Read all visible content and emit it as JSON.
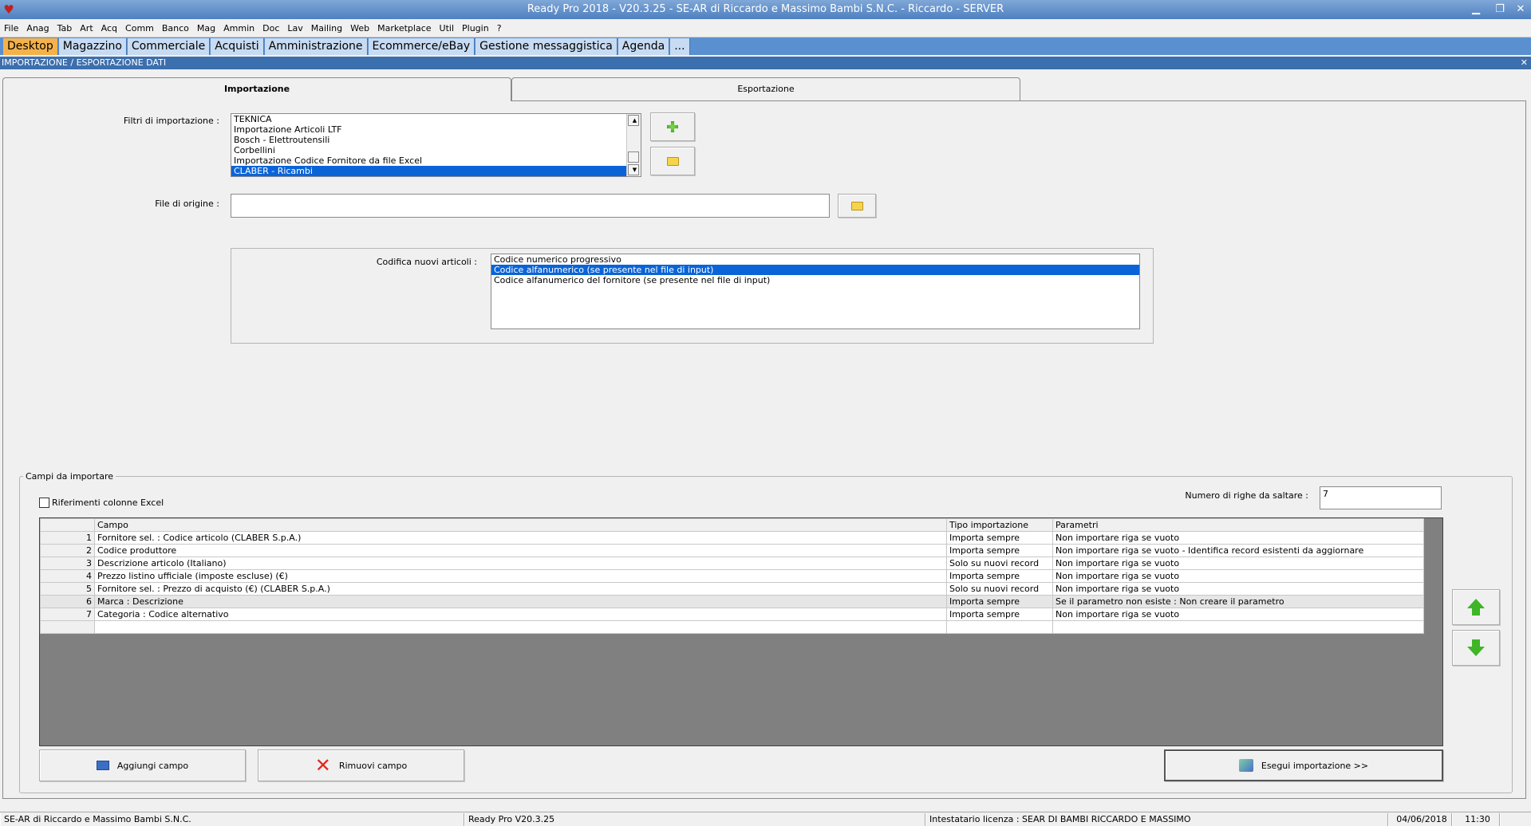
{
  "window": {
    "title": "Ready Pro 2018 - V20.3.25 - SE-AR di Riccardo e Massimo Bambi S.N.C. - Riccardo - SERVER"
  },
  "menu": [
    "File",
    "Anag",
    "Tab",
    "Art",
    "Acq",
    "Comm",
    "Banco",
    "Mag",
    "Ammin",
    "Doc",
    "Lav",
    "Mailing",
    "Web",
    "Marketplace",
    "Util",
    "Plugin",
    "?"
  ],
  "tabs": [
    "Desktop",
    "Magazzino",
    "Commerciale",
    "Acquisti",
    "Amministrazione",
    "Ecommerce/eBay",
    "Gestione messaggistica",
    "Agenda",
    "..."
  ],
  "module_title": "IMPORTAZIONE / ESPORTAZIONE DATI",
  "panel_tabs": {
    "import": "Importazione",
    "export": "Esportazione"
  },
  "filters": {
    "label": "Filtri di importazione :",
    "items": [
      "TEKNICA",
      "Importazione Articoli LTF",
      "Bosch - Elettroutensili",
      "Corbellini",
      "Importazione Codice Fornitore da file Excel",
      "CLABER - Ricambi"
    ],
    "selected": "CLABER - Ricambi"
  },
  "origin_file": {
    "label": "File di origine :",
    "value": ""
  },
  "coding": {
    "label": "Codifica nuovi articoli :",
    "items": [
      "Codice numerico progressivo",
      "Codice alfanumerico (se presente nel file di input)",
      "Codice alfanumerico del fornitore (se presente nel file di input)"
    ],
    "selected": "Codice alfanumerico (se presente nel file di input)"
  },
  "fields_group": {
    "legend": "Campi da importare",
    "excel_refs_label": "Riferimenti colonne Excel",
    "skip_rows_label": "Numero di righe da saltare :",
    "skip_rows_value": "7",
    "columns": [
      "",
      "Campo",
      "Tipo importazione",
      "Parametri"
    ],
    "rows": [
      {
        "n": "1",
        "campo": "Fornitore sel. : Codice articolo (CLABER S.p.A.)",
        "tipo": "Importa sempre",
        "param": "Non importare riga se vuoto"
      },
      {
        "n": "2",
        "campo": "Codice produttore",
        "tipo": "Importa sempre",
        "param": "Non importare riga se vuoto - Identifica record esistenti da aggiornare"
      },
      {
        "n": "3",
        "campo": "Descrizione articolo (Italiano)",
        "tipo": "Solo su nuovi record",
        "param": "Non importare riga se vuoto"
      },
      {
        "n": "4",
        "campo": "Prezzo listino ufficiale (imposte escluse) (€)",
        "tipo": "Importa sempre",
        "param": "Non importare riga se vuoto"
      },
      {
        "n": "5",
        "campo": "Fornitore sel. : Prezzo di acquisto (€) (CLABER S.p.A.)",
        "tipo": "Solo su nuovi record",
        "param": "Non importare riga se vuoto"
      },
      {
        "n": "6",
        "campo": "Marca : Descrizione",
        "tipo": "Importa sempre",
        "param": "Se il parametro non esiste : Non creare il parametro"
      },
      {
        "n": "7",
        "campo": "Categoria : Codice alternativo",
        "tipo": "Importa sempre",
        "param": "Non importare riga se vuoto"
      }
    ]
  },
  "buttons": {
    "add_field": "Aggiungi campo",
    "remove_field": "Rimuovi campo",
    "run_import": "Esegui importazione >>"
  },
  "status": {
    "company": "SE-AR di Riccardo e Massimo Bambi S.N.C.",
    "version": "Ready Pro V20.3.25",
    "license": "Intestatario licenza : SEAR DI BAMBI RICCARDO E MASSIMO",
    "date": "04/06/2018",
    "time": "11:30"
  }
}
